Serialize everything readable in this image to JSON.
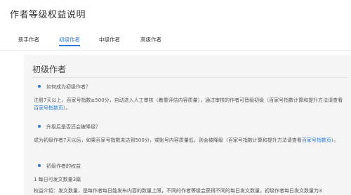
{
  "page": {
    "title": "作者等级权益说明"
  },
  "tabs": [
    {
      "label": "新手作者"
    },
    {
      "label": "初级作者"
    },
    {
      "label": "中级作者"
    },
    {
      "label": "高级作者"
    }
  ],
  "section": {
    "title": "初级作者",
    "q1": "如何成为初级作者？",
    "p1_text": "注册7天以上，百家号指数≥500分，自动进入人工审核（着重评估内容质量），通过审核的作者可晋级初级（百家号指数计算和提升方法请查看",
    "p1_link": "百家号指数页",
    "p1_end": "）。",
    "q2": "升级后是否还会被降级？",
    "p2_text": "成为初级作者7天以后，如果百家号指数未达到500分，或账号内容质量低，则会被降级（百家号指数计算和提升方法请查看",
    "p2_link": "百家号指数",
    "p2_link2": "页",
    "p2_end": "）。",
    "q3": "初级作者的权益",
    "item1": "1 每日可发文数量3篇",
    "item1_desc": "权益介绍：发文数量，是每作者每日能发布内容的数量上限，不同的作者等级会获得不同的每日发文数量。初级作者每日发文数量为3"
  }
}
